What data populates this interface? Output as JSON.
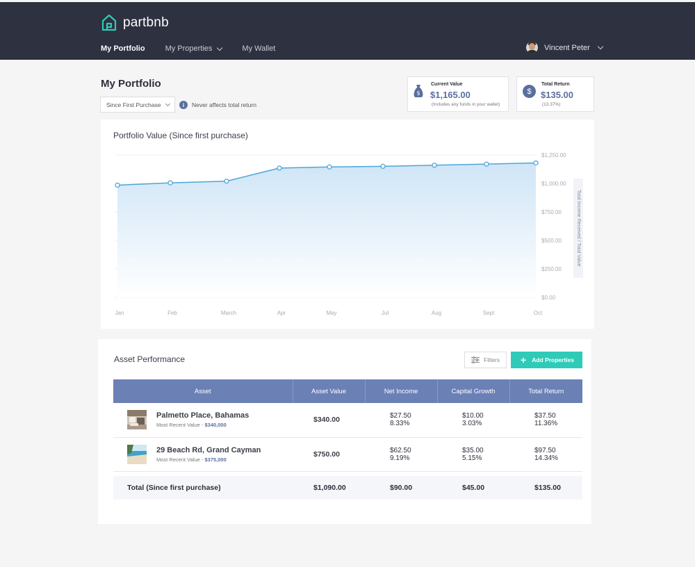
{
  "brand": {
    "name": "partbnb",
    "accent": "#2fcbb8"
  },
  "nav": {
    "items": [
      {
        "label": "My Portfolio",
        "active": true
      },
      {
        "label": "My Properties",
        "dropdown": true
      },
      {
        "label": "My Wallet"
      }
    ]
  },
  "user": {
    "name": "Vincent Peter"
  },
  "page": {
    "title": "My Portfolio",
    "period_select": "Since First Purchase",
    "info_note": "Never affects total return"
  },
  "stats": {
    "current": {
      "label": "Current Value",
      "value": "$1,165.00",
      "sub": "(Includes any funds in your wallet)",
      "icon": "money-bag-icon"
    },
    "return": {
      "label": "Total Return",
      "value": "$135.00",
      "sub": "(13.37%)",
      "icon": "dollar-icon"
    }
  },
  "chart_data": {
    "type": "area",
    "title": "Portfolio Value (Since first purchase)",
    "x": [
      "Jan",
      "Feb",
      "March",
      "Apr",
      "May",
      "Jul",
      "Aug",
      "Sept",
      "Oct"
    ],
    "values": [
      985,
      1005,
      1020,
      1135,
      1145,
      1150,
      1160,
      1170,
      1180
    ],
    "ylim": [
      0,
      1250
    ],
    "yticks": [
      "$1,250.00",
      "$1,000.00",
      "$750.00",
      "$500.00",
      "$250.00",
      "$0.00"
    ],
    "ylabel_right": "Total Income Received / Total Value",
    "line_color": "#4ea6d6"
  },
  "assets": {
    "title": "Asset Performance",
    "filters_label": "Filters",
    "add_label": "Add Properties",
    "columns": [
      "Asset",
      "Asset Value",
      "Net Income",
      "Capital Growth",
      "Total Return"
    ],
    "rows": [
      {
        "name": "Palmetto Place, Bahamas",
        "recent_label": "Most Recent Value - ",
        "recent_value": "$340,000",
        "asset_value": "$340.00",
        "net_income": "$27.50",
        "net_income_pct": "8.33%",
        "capital_growth": "$10.00",
        "capital_growth_pct": "3.03%",
        "total_return": "$37.50",
        "total_return_pct": "11.36%"
      },
      {
        "name": "29 Beach Rd, Grand Cayman",
        "recent_label": "Most Recent Value - ",
        "recent_value": "$375,000",
        "asset_value": "$750.00",
        "net_income": "$62.50",
        "net_income_pct": "9.19%",
        "capital_growth": "$35.00",
        "capital_growth_pct": "5.15%",
        "total_return": "$97.50",
        "total_return_pct": "14.34%"
      }
    ],
    "total": {
      "label": "Total (Since first purchase)",
      "asset_value": "$1,090.00",
      "net_income": "$90.00",
      "capital_growth": "$45.00",
      "total_return": "$135.00"
    }
  }
}
